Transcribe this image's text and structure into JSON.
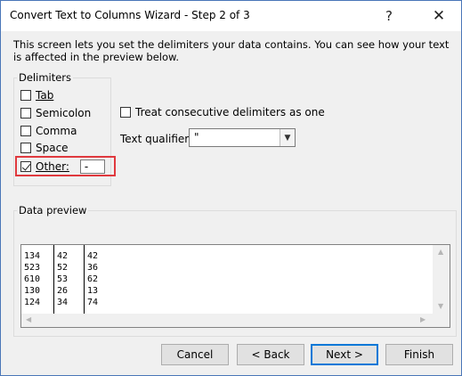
{
  "dialog": {
    "title": "Convert Text to Columns Wizard - Step 2 of 3",
    "help_symbol": "?",
    "close_symbol": "✕",
    "intro": "This screen lets you set the delimiters your data contains.  You can see how your text is affected in the preview below."
  },
  "delimiters": {
    "group_label": "Delimiters",
    "items": [
      {
        "label": "Tab",
        "checked": false
      },
      {
        "label": "Semicolon",
        "checked": false
      },
      {
        "label": "Comma",
        "checked": false
      },
      {
        "label": "Space",
        "checked": false
      },
      {
        "label": "Other:",
        "checked": true
      }
    ],
    "other_value": "-"
  },
  "options": {
    "consecutive_label": "Treat consecutive delimiters as one",
    "consecutive_checked": false,
    "qualifier_label": "Text qualifier:",
    "qualifier_value": "\""
  },
  "preview": {
    "group_label": "Data preview",
    "columns": [
      [
        "134",
        "523",
        "610",
        "130",
        "124"
      ],
      [
        "42",
        "52",
        "53",
        "26",
        "34"
      ],
      [
        "42",
        "36",
        "62",
        "13",
        "74"
      ]
    ]
  },
  "buttons": {
    "cancel": "Cancel",
    "back": "< Back",
    "next": "Next >",
    "finish": "Finish"
  },
  "colors": {
    "highlight": "#e0393e",
    "accent": "#0078d7"
  }
}
